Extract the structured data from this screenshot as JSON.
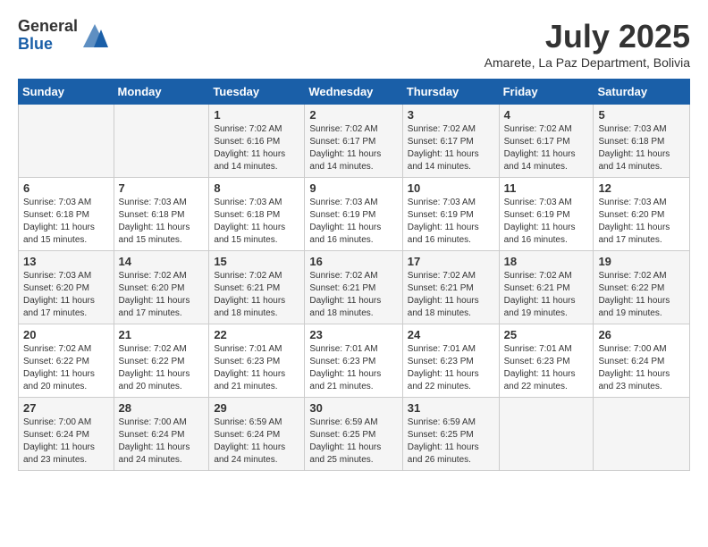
{
  "logo": {
    "general": "General",
    "blue": "Blue"
  },
  "title": "July 2025",
  "location": "Amarete, La Paz Department, Bolivia",
  "days_of_week": [
    "Sunday",
    "Monday",
    "Tuesday",
    "Wednesday",
    "Thursday",
    "Friday",
    "Saturday"
  ],
  "weeks": [
    [
      {
        "day": "",
        "info": ""
      },
      {
        "day": "",
        "info": ""
      },
      {
        "day": "1",
        "info": "Sunrise: 7:02 AM\nSunset: 6:16 PM\nDaylight: 11 hours and 14 minutes."
      },
      {
        "day": "2",
        "info": "Sunrise: 7:02 AM\nSunset: 6:17 PM\nDaylight: 11 hours and 14 minutes."
      },
      {
        "day": "3",
        "info": "Sunrise: 7:02 AM\nSunset: 6:17 PM\nDaylight: 11 hours and 14 minutes."
      },
      {
        "day": "4",
        "info": "Sunrise: 7:02 AM\nSunset: 6:17 PM\nDaylight: 11 hours and 14 minutes."
      },
      {
        "day": "5",
        "info": "Sunrise: 7:03 AM\nSunset: 6:18 PM\nDaylight: 11 hours and 14 minutes."
      }
    ],
    [
      {
        "day": "6",
        "info": "Sunrise: 7:03 AM\nSunset: 6:18 PM\nDaylight: 11 hours and 15 minutes."
      },
      {
        "day": "7",
        "info": "Sunrise: 7:03 AM\nSunset: 6:18 PM\nDaylight: 11 hours and 15 minutes."
      },
      {
        "day": "8",
        "info": "Sunrise: 7:03 AM\nSunset: 6:18 PM\nDaylight: 11 hours and 15 minutes."
      },
      {
        "day": "9",
        "info": "Sunrise: 7:03 AM\nSunset: 6:19 PM\nDaylight: 11 hours and 16 minutes."
      },
      {
        "day": "10",
        "info": "Sunrise: 7:03 AM\nSunset: 6:19 PM\nDaylight: 11 hours and 16 minutes."
      },
      {
        "day": "11",
        "info": "Sunrise: 7:03 AM\nSunset: 6:19 PM\nDaylight: 11 hours and 16 minutes."
      },
      {
        "day": "12",
        "info": "Sunrise: 7:03 AM\nSunset: 6:20 PM\nDaylight: 11 hours and 17 minutes."
      }
    ],
    [
      {
        "day": "13",
        "info": "Sunrise: 7:03 AM\nSunset: 6:20 PM\nDaylight: 11 hours and 17 minutes."
      },
      {
        "day": "14",
        "info": "Sunrise: 7:02 AM\nSunset: 6:20 PM\nDaylight: 11 hours and 17 minutes."
      },
      {
        "day": "15",
        "info": "Sunrise: 7:02 AM\nSunset: 6:21 PM\nDaylight: 11 hours and 18 minutes."
      },
      {
        "day": "16",
        "info": "Sunrise: 7:02 AM\nSunset: 6:21 PM\nDaylight: 11 hours and 18 minutes."
      },
      {
        "day": "17",
        "info": "Sunrise: 7:02 AM\nSunset: 6:21 PM\nDaylight: 11 hours and 18 minutes."
      },
      {
        "day": "18",
        "info": "Sunrise: 7:02 AM\nSunset: 6:21 PM\nDaylight: 11 hours and 19 minutes."
      },
      {
        "day": "19",
        "info": "Sunrise: 7:02 AM\nSunset: 6:22 PM\nDaylight: 11 hours and 19 minutes."
      }
    ],
    [
      {
        "day": "20",
        "info": "Sunrise: 7:02 AM\nSunset: 6:22 PM\nDaylight: 11 hours and 20 minutes."
      },
      {
        "day": "21",
        "info": "Sunrise: 7:02 AM\nSunset: 6:22 PM\nDaylight: 11 hours and 20 minutes."
      },
      {
        "day": "22",
        "info": "Sunrise: 7:01 AM\nSunset: 6:23 PM\nDaylight: 11 hours and 21 minutes."
      },
      {
        "day": "23",
        "info": "Sunrise: 7:01 AM\nSunset: 6:23 PM\nDaylight: 11 hours and 21 minutes."
      },
      {
        "day": "24",
        "info": "Sunrise: 7:01 AM\nSunset: 6:23 PM\nDaylight: 11 hours and 22 minutes."
      },
      {
        "day": "25",
        "info": "Sunrise: 7:01 AM\nSunset: 6:23 PM\nDaylight: 11 hours and 22 minutes."
      },
      {
        "day": "26",
        "info": "Sunrise: 7:00 AM\nSunset: 6:24 PM\nDaylight: 11 hours and 23 minutes."
      }
    ],
    [
      {
        "day": "27",
        "info": "Sunrise: 7:00 AM\nSunset: 6:24 PM\nDaylight: 11 hours and 23 minutes."
      },
      {
        "day": "28",
        "info": "Sunrise: 7:00 AM\nSunset: 6:24 PM\nDaylight: 11 hours and 24 minutes."
      },
      {
        "day": "29",
        "info": "Sunrise: 6:59 AM\nSunset: 6:24 PM\nDaylight: 11 hours and 24 minutes."
      },
      {
        "day": "30",
        "info": "Sunrise: 6:59 AM\nSunset: 6:25 PM\nDaylight: 11 hours and 25 minutes."
      },
      {
        "day": "31",
        "info": "Sunrise: 6:59 AM\nSunset: 6:25 PM\nDaylight: 11 hours and 26 minutes."
      },
      {
        "day": "",
        "info": ""
      },
      {
        "day": "",
        "info": ""
      }
    ]
  ]
}
